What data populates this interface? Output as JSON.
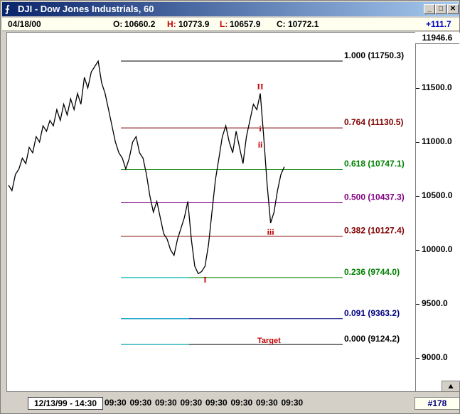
{
  "window": {
    "title": "DJI - Dow Jones Industrials, 60",
    "buttons": {
      "minimize": "_",
      "maximize": "□",
      "close": "✕"
    }
  },
  "infobar": {
    "date": "04/18/00",
    "open_label": "O:",
    "open": "10660.2",
    "high_label": "H:",
    "high": "10773.9",
    "low_label": "L:",
    "low": "10657.9",
    "close_label": "C:",
    "close": "10772.1",
    "change": "+111.7"
  },
  "axis": {
    "top_value": "11946.6",
    "ticks": [
      "11500.0",
      "11000.0",
      "10500.0",
      "10000.0",
      "9500.0",
      "9000.0"
    ]
  },
  "bottom": {
    "date_box": "12/13/99 - 14:30",
    "x_ticks": [
      "09:30",
      "09:30",
      "09:30",
      "09:30",
      "09:30",
      "09:30",
      "09:30",
      "09:30"
    ],
    "count": "#178"
  },
  "chart_data": {
    "type": "line",
    "ylim": [
      8850,
      12000
    ],
    "y_ticks": [
      11500,
      11000,
      10500,
      10000,
      9500,
      9000
    ],
    "fib_levels": [
      {
        "label": "1.000 (11750.3)",
        "value": 11750.3,
        "color": "#000000"
      },
      {
        "label": "0.764 (11130.5)",
        "value": 11130.5,
        "color": "#800000"
      },
      {
        "label": "0.618 (10747.1)",
        "value": 10747.1,
        "color": "#008000"
      },
      {
        "label": "0.500 (10437.3)",
        "value": 10437.3,
        "color": "#800080"
      },
      {
        "label": "0.382 (10127.4)",
        "value": 10127.4,
        "color": "#800000"
      },
      {
        "label": "0.236 (9744.0)",
        "value": 9744.0,
        "color": "#008000"
      },
      {
        "label": "0.091 (9363.2)",
        "value": 9363.2,
        "color": "#000080"
      },
      {
        "label": "0.000 (9124.2)",
        "value": 9124.2,
        "color": "#000000"
      }
    ],
    "wave_labels": [
      {
        "text": "I",
        "bar": 57,
        "value": 9700
      },
      {
        "text": "II",
        "bar": 73,
        "value": 11490
      },
      {
        "text": "i",
        "bar": 73,
        "value": 11100
      },
      {
        "text": "ii",
        "bar": 73,
        "value": 10950
      },
      {
        "text": "iii",
        "bar": 76,
        "value": 10140
      }
    ],
    "target_label": {
      "text": "Target",
      "value": 9124.2
    },
    "series": [
      {
        "values": [
          10600,
          10550,
          10700,
          10750,
          10850,
          10800,
          10950,
          10900,
          11050,
          11000,
          11150,
          11100,
          11200,
          11150,
          11300,
          11200,
          11350,
          11250,
          11400,
          11300,
          11450,
          11350,
          11600,
          11500,
          11650,
          11700,
          11750,
          11550,
          11450,
          11300,
          11150,
          11000,
          10900,
          10850,
          10750,
          10850,
          11000,
          11050,
          10900,
          10850,
          10700,
          10500,
          10350,
          10450,
          10300,
          10150,
          10100,
          10000,
          9950,
          10100,
          10200,
          10300,
          10450,
          10100,
          9850,
          9780,
          9800,
          9850,
          10050,
          10350,
          10650,
          10850,
          11050,
          11150,
          11000,
          10900,
          11100,
          10950,
          10800,
          11050,
          11200,
          11350,
          11300,
          11450,
          11050,
          10600,
          10250,
          10350,
          10550,
          10700,
          10772
        ]
      }
    ]
  }
}
